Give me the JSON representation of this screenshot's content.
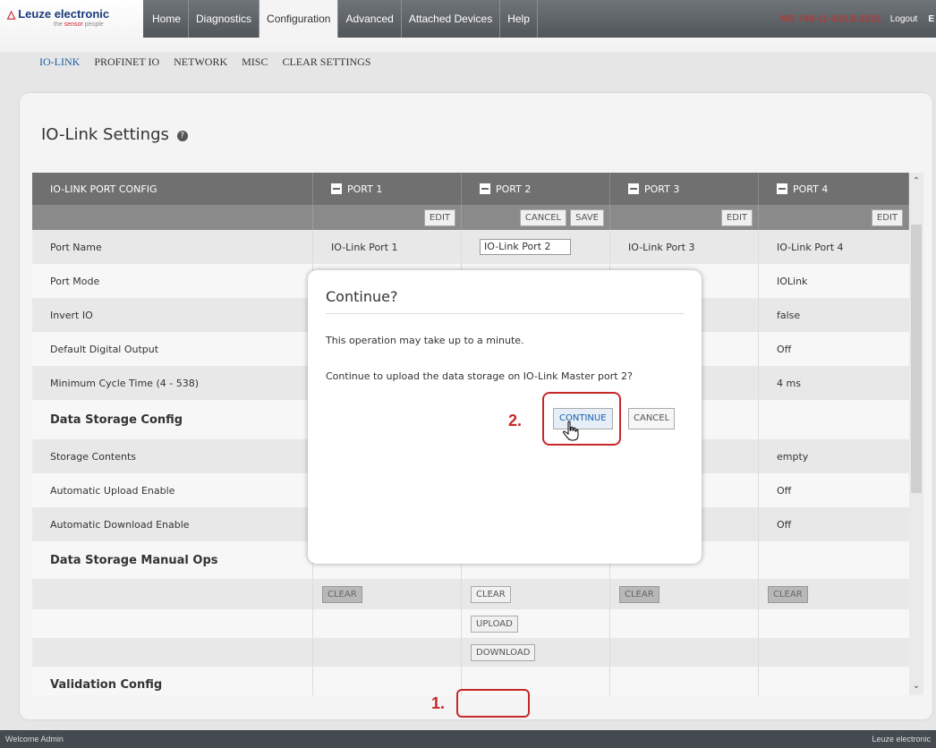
{
  "brand": {
    "name": "Leuze electronic",
    "tagline_pre": "the ",
    "tagline_red": "sensor",
    "tagline_post": " people"
  },
  "nav": {
    "tabs": [
      "Home",
      "Diagnostics",
      "Configuration",
      "Advanced",
      "Attached Devices",
      "Help"
    ],
    "active": "Configuration"
  },
  "header_right": {
    "device_id": "MD 748-11-42/L5-2222",
    "logout": "Logout",
    "lang": "E"
  },
  "subnav": {
    "items": [
      "IO-LINK",
      "PROFINET IO",
      "NETWORK",
      "MISC",
      "CLEAR SETTINGS"
    ],
    "active": "IO-LINK"
  },
  "page": {
    "title": "IO-Link Settings",
    "help_icon": "?"
  },
  "table": {
    "header_label": "IO-LINK PORT CONFIG",
    "ports": [
      "PORT 1",
      "PORT 2",
      "PORT 3",
      "PORT 4"
    ],
    "edit_label": "EDIT",
    "cancel_label": "CANCEL",
    "save_label": "SAVE",
    "rows": [
      {
        "label": "Port Name",
        "values": [
          "IO-Link Port 1",
          "IO-Link Port 2",
          "IO-Link Port 3",
          "IO-Link Port 4"
        ]
      },
      {
        "label": "Port Mode",
        "values": [
          "",
          "",
          "",
          "IOLink"
        ]
      },
      {
        "label": "Invert IO",
        "values": [
          "",
          "",
          "",
          "false"
        ]
      },
      {
        "label": "Default Digital Output",
        "values": [
          "",
          "",
          "",
          "Off"
        ]
      },
      {
        "label": "Minimum Cycle Time (4 - 538)",
        "values": [
          "",
          "",
          "",
          "4 ms"
        ]
      }
    ],
    "section_data_storage": "Data Storage Config",
    "ds_rows": [
      {
        "label": "Storage Contents",
        "values": [
          "",
          "",
          "",
          "empty"
        ]
      },
      {
        "label": "Automatic Upload Enable",
        "values": [
          "",
          "",
          "",
          "Off"
        ]
      },
      {
        "label": "Automatic Download Enable",
        "values": [
          "",
          "",
          "",
          "Off"
        ]
      }
    ],
    "section_manual_ops": "Data Storage Manual Ops",
    "clear_label": "CLEAR",
    "upload_label": "UPLOAD",
    "download_label": "DOWNLOAD",
    "section_validation": "Validation Config"
  },
  "modal": {
    "title": "Continue?",
    "message1": "This operation may take up to a minute.",
    "message2": "Continue to upload the data storage on IO-Link Master port 2?",
    "continue_label": "CONTINUE",
    "cancel_label": "CANCEL",
    "step2": "2."
  },
  "annotation": {
    "step1": "1."
  },
  "footer": {
    "left": "Welcome Admin",
    "right": "Leuze electronic"
  },
  "colors": {
    "brand_red": "#d0202a",
    "brand_blue": "#1a3a7a",
    "annotation_red": "#c62828",
    "nav_dark": "#5a5f63"
  }
}
